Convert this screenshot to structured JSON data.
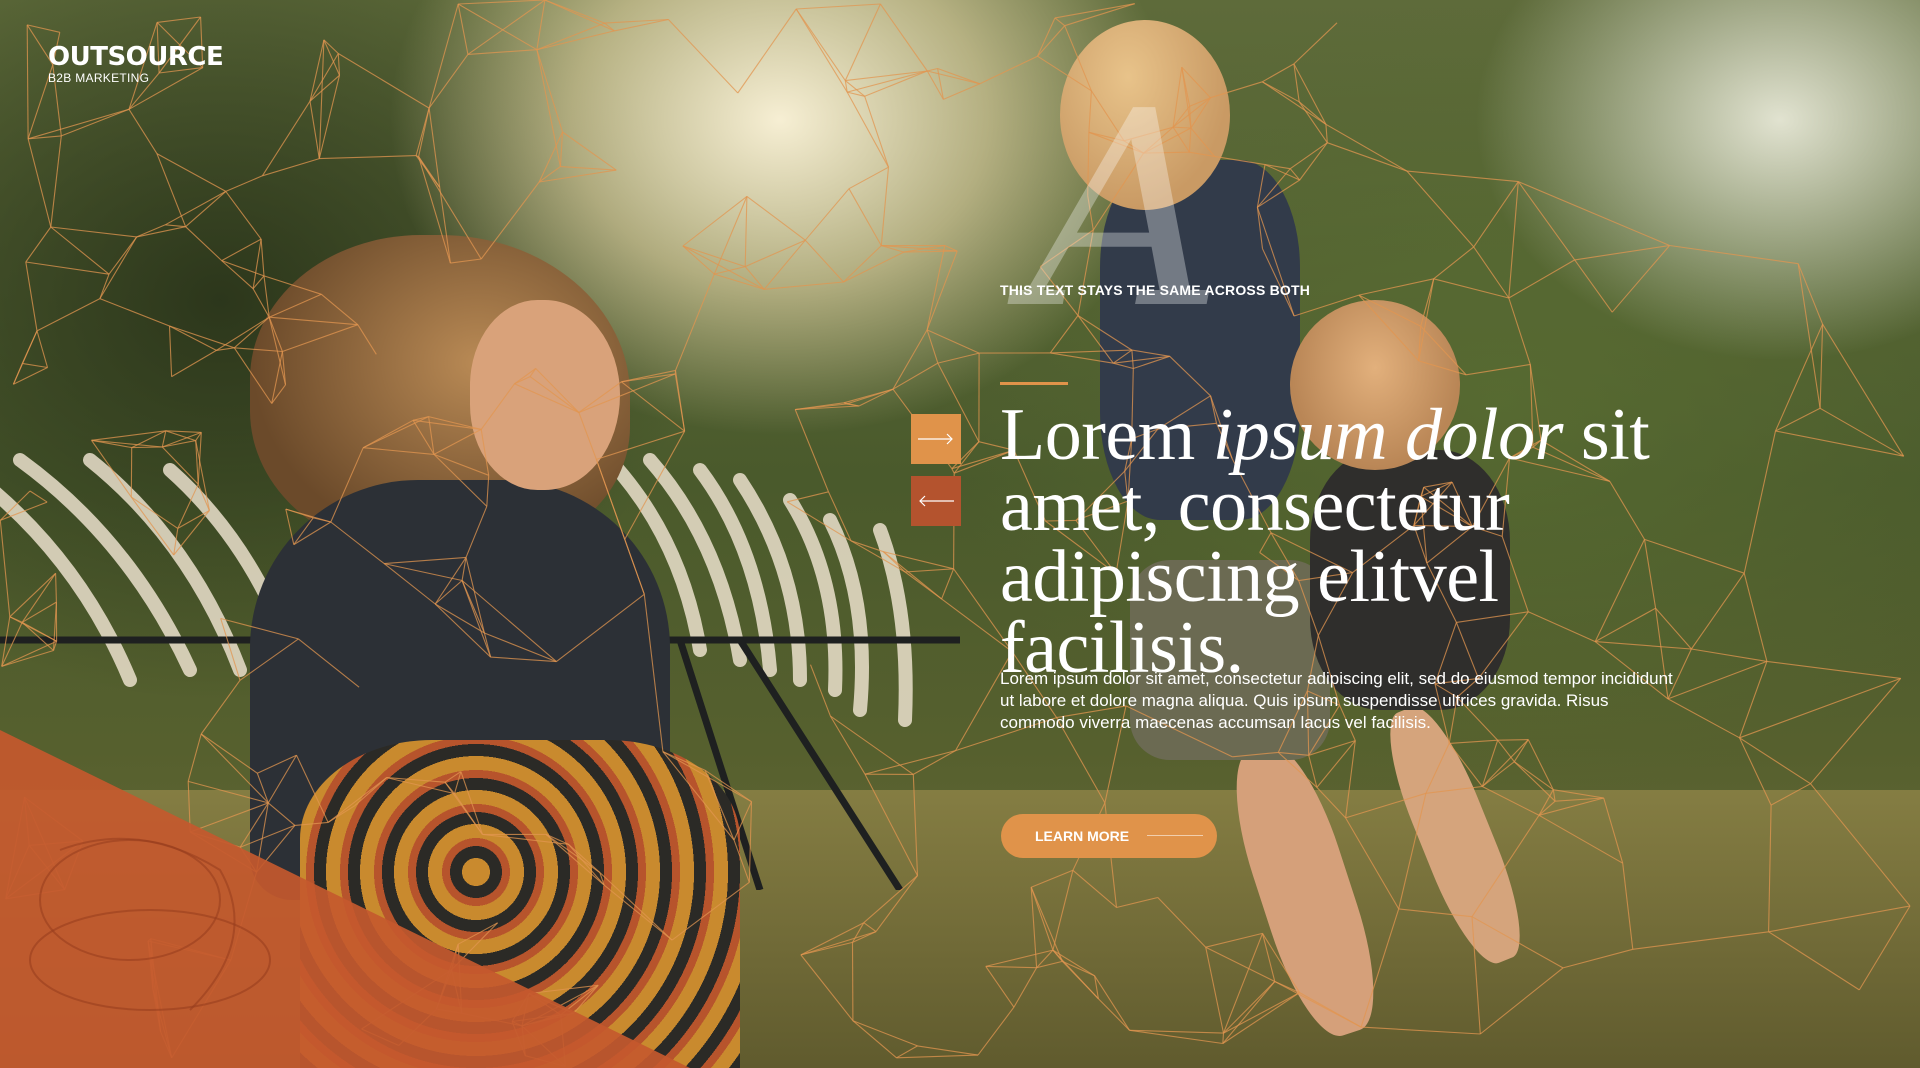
{
  "brand": {
    "name": "OUTSOURCE",
    "tagline": "B2B MARKETING"
  },
  "hero": {
    "decorative_letter": "A",
    "eyebrow": "THIS TEXT STAYS THE SAME ACROSS BOTH",
    "headline": {
      "part1": "Lorem ",
      "italic": "ipsum dolor",
      "part2": " sit amet, consectetur adipiscing elitvel facilisis."
    },
    "body": "Lorem ipsum dolor sit amet, consectetur adipiscing elit, sed do eiusmod tempor incididunt ut labore et dolore magna aliqua. Quis ipsum suspendisse ultrices gravida. Risus commodo viverra maecenas accumsan lacus vel facilisis.",
    "cta_label": "LEARN MORE"
  },
  "navigation": {
    "next_icon": "arrow-right-icon",
    "prev_icon": "arrow-left-icon"
  },
  "colors": {
    "accent": "#e0934a",
    "accent_dark": "#b4532e",
    "text": "#ffffff"
  }
}
